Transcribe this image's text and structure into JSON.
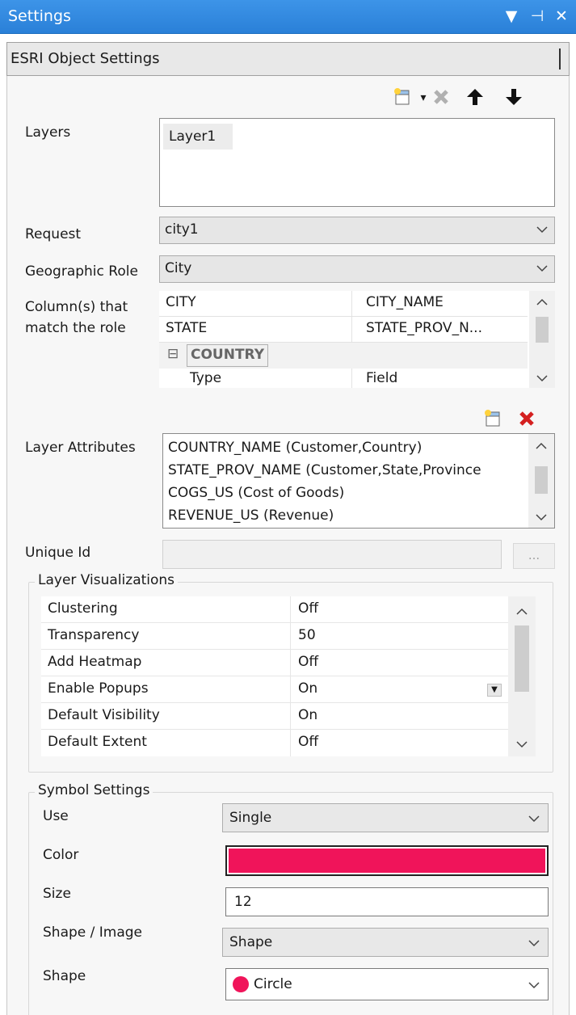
{
  "titlebar": {
    "title": "Settings",
    "icons": [
      "dropdown-arrow-icon",
      "pin-icon",
      "close-icon"
    ]
  },
  "subheader": {
    "title": "ESRI Object Settings"
  },
  "layers": {
    "label": "Layers",
    "items": [
      "Layer1"
    ],
    "toolbar_icons": [
      "new-layer-icon",
      "dropdown-icon",
      "delete-icon",
      "move-up-icon",
      "move-down-icon"
    ]
  },
  "request": {
    "label": "Request",
    "value": "city1"
  },
  "geographic_role": {
    "label": "Geographic Role",
    "value": "City"
  },
  "columns": {
    "label_line1": "Column(s) that",
    "label_line2": "match the role",
    "rows": [
      {
        "name": "CITY",
        "value": "CITY_NAME"
      },
      {
        "name": "STATE",
        "value": "STATE_PROV_N..."
      }
    ],
    "group": {
      "toggle": "⊟",
      "name": "COUNTRY"
    },
    "sub_rows": [
      {
        "name": "Type",
        "value": "Field"
      }
    ]
  },
  "layer_attributes": {
    "label": "Layer Attributes",
    "items": [
      "COUNTRY_NAME (Customer,Country)",
      "STATE_PROV_NAME (Customer,State,Province",
      "COGS_US (Cost of Goods)",
      "REVENUE_US (Revenue)"
    ]
  },
  "unique_id": {
    "label": "Unique Id",
    "value": "",
    "browse_label": "..."
  },
  "visualizations": {
    "title": "Layer Visualizations",
    "rows": [
      {
        "name": "Clustering",
        "value": "Off"
      },
      {
        "name": "Transparency",
        "value": "50"
      },
      {
        "name": "Add Heatmap",
        "value": "Off"
      },
      {
        "name": "Enable Popups",
        "value": "On"
      },
      {
        "name": "Default Visibility",
        "value": "On"
      },
      {
        "name": "Default Extent",
        "value": "Off"
      }
    ]
  },
  "symbol": {
    "title": "Symbol Settings",
    "use": {
      "label": "Use",
      "value": "Single"
    },
    "color": {
      "label": "Color",
      "swatch": "#f0145a"
    },
    "size": {
      "label": "Size",
      "value": "12"
    },
    "shape_image": {
      "label": "Shape / Image",
      "value": "Shape"
    },
    "shape": {
      "label": "Shape",
      "value": "Circle",
      "swatch": "#f0145a"
    }
  },
  "colors": {
    "titlebar": "#2a80d8",
    "delete_red": "#d42020",
    "symbol": "#f0145a"
  }
}
